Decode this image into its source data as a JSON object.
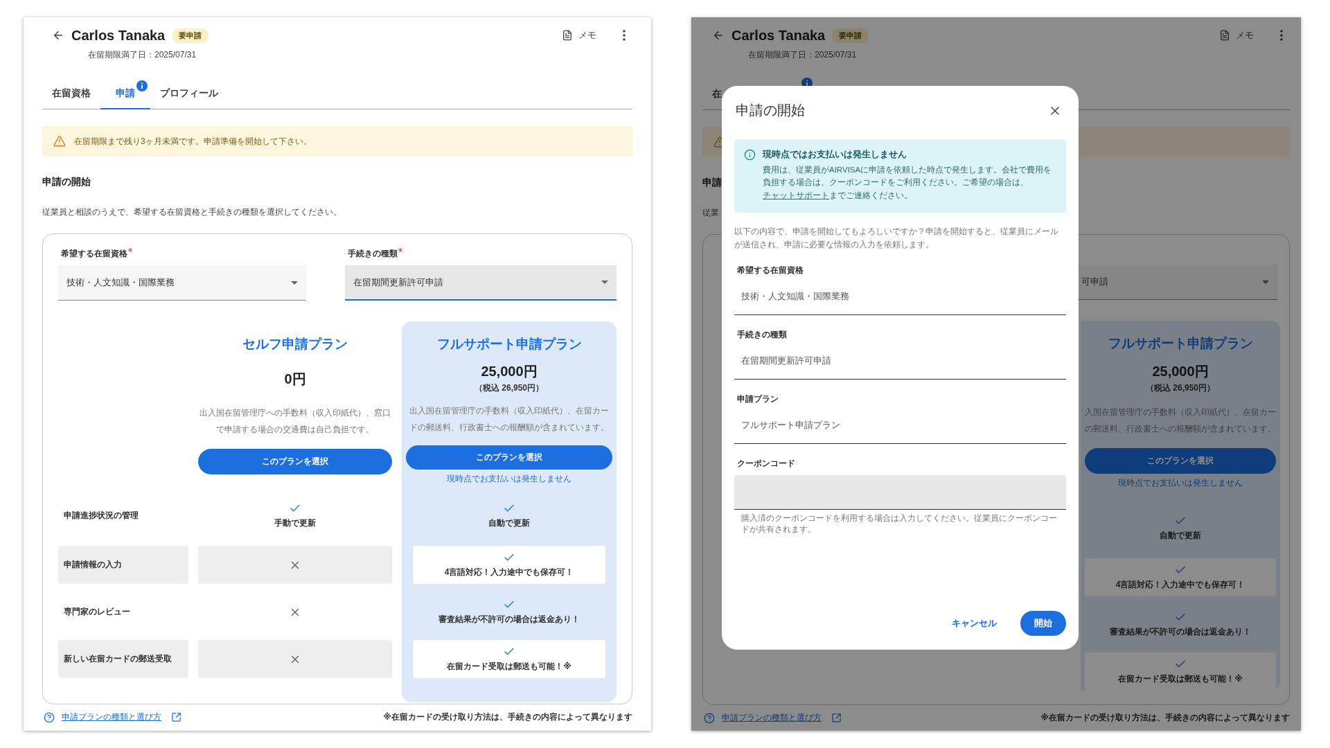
{
  "main_view": {
    "header": {
      "name": "Carlos Tanaka",
      "badge": "要申請",
      "expiry": "在留期限満了日：2025/07/31",
      "memo": "メモ"
    },
    "tabs": [
      {
        "label": "在留資格",
        "selected": false,
        "badge": false
      },
      {
        "label": "申請",
        "selected": true,
        "badge": true
      },
      {
        "label": "プロフィール",
        "selected": false,
        "badge": false
      }
    ],
    "alert": {
      "kind": "warning",
      "text": "在留期限まで残り3ヶ月未満です。申請準備を開始して下さい。"
    },
    "section": {
      "title": "申請の開始",
      "description": "従業員と相談のうえで、希望する在留資格と手続きの種類を選択してください。"
    },
    "selects": [
      {
        "label": "希望する在留資格",
        "required": true,
        "value": "技術・人文知識・国際業務",
        "focused": false
      },
      {
        "label": "手続きの種類",
        "required": true,
        "value": "在留期間更新許可申請",
        "focused": true
      }
    ],
    "plans": [
      {
        "name": "セルフ申請プラン",
        "price": "0円",
        "description": "出入国在留管理庁への手数料（収入印紙代）、窓口で申請する場合の交通費は自己負担です。",
        "button": "このプランを選択",
        "highlighted": false
      },
      {
        "name": "フルサポート申請プラン",
        "price": "25,000円",
        "tax_note": "（税込 26,950円）",
        "description": "出入国在留管理庁の手数料（収入印紙代）、在留カードの郵送料、行政書士への報酬額が含まれています。",
        "button": "このプランを選択",
        "note": "現時点でお支払いは発生しません",
        "highlighted": true
      }
    ],
    "features": [
      {
        "label": "申請進捗状況の管理",
        "shaded": false,
        "cells": [
          {
            "kind": "check",
            "text": "手動で更新"
          },
          {
            "kind": "check",
            "text": "自動で更新"
          }
        ]
      },
      {
        "label": "申請情報の入力",
        "shaded": true,
        "cells": [
          {
            "kind": "cross"
          },
          {
            "kind": "check",
            "text": "4言語対応！入力途中でも保存可！"
          }
        ]
      },
      {
        "label": "専門家のレビュー",
        "shaded": false,
        "cells": [
          {
            "kind": "cross"
          },
          {
            "kind": "check",
            "text": "審査結果が不許可の場合は返金あり！"
          }
        ]
      },
      {
        "label": "新しい在留カードの郵送受取",
        "shaded": true,
        "cells": [
          {
            "kind": "cross"
          },
          {
            "kind": "check",
            "text": "在留カード受取は郵送も可能！※"
          }
        ]
      }
    ],
    "footer": {
      "help_link": "申請プランの種類と選び方",
      "footnote": "※在留カードの受け取り方法は、手続きの内容によって異なります"
    }
  },
  "dialog_view": {
    "background": {
      "header": {
        "name": "Carlos Tanaka",
        "badge": "要申請",
        "expiry": "在留期限満了日：2025/07/31",
        "memo": "メモ"
      },
      "tab": "在",
      "tab_badge": true,
      "alert_warning": true,
      "section_title": "申請",
      "description": "従業",
      "select_value": "可申請",
      "plan": {
        "name": "フルサポート申請プラン",
        "price": "25,000円",
        "tax_note": "（税込 26,950円）",
        "description_lines": [
          "入国在留管理庁の手数料（収入印紙代）、在留カー",
          "の郵送料、行政書士への報酬額が含まれています。"
        ],
        "button": "このプランを選択",
        "note": "現時点でお支払いは発生しません"
      },
      "features": [
        {
          "shaded": false,
          "kind": "check",
          "text": "自動で更新"
        },
        {
          "shaded": true,
          "kind": "check",
          "text": "4言語対応！入力途中でも保存可！"
        },
        {
          "shaded": false,
          "kind": "check",
          "text": "審査結果が不許可の場合は返金あり！"
        },
        {
          "shaded": true,
          "kind": "check",
          "text": "在留カード受取は郵送も可能！※"
        }
      ],
      "footer": {
        "help_link": "申請プランの種類と選び方",
        "footnote": "※在留カードの受け取り方法は、手続きの内容によって異なります"
      }
    },
    "dialog": {
      "title": "申請の開始",
      "info": {
        "title": "現時点ではお支払いは発生しません",
        "text_before": "費用は、従業員がAIRVISAに申請を依頼した時点で発生します。会社で費用を負担する場合は、クーポンコードをご利用ください。ご希望の場合は、",
        "link": "チャットサポート",
        "text_after": "までご連絡ください。"
      },
      "message": "以下の内容で、申請を開始してもよろしいですか？申請を開始すると、従業員にメールが送信され、申請に必要な情報の入力を依頼します。",
      "fields": [
        {
          "kind": "readonly",
          "label": "希望する在留資格",
          "value": "技術・人文知識・国際業務"
        },
        {
          "kind": "readonly",
          "label": "手続きの種類",
          "value": "在留期間更新許可申請"
        },
        {
          "kind": "readonly",
          "label": "申請プラン",
          "value": "フルサポート申請プラン"
        },
        {
          "kind": "input",
          "label": "クーポンコード",
          "helper": "購入済のクーポンコードを利用する場合は入力してください。従業員にクーポンコードが共有されます。"
        }
      ],
      "actions": [
        {
          "label": "キャンセル",
          "kind": "text"
        },
        {
          "label": "開始",
          "kind": "filled"
        }
      ]
    }
  }
}
